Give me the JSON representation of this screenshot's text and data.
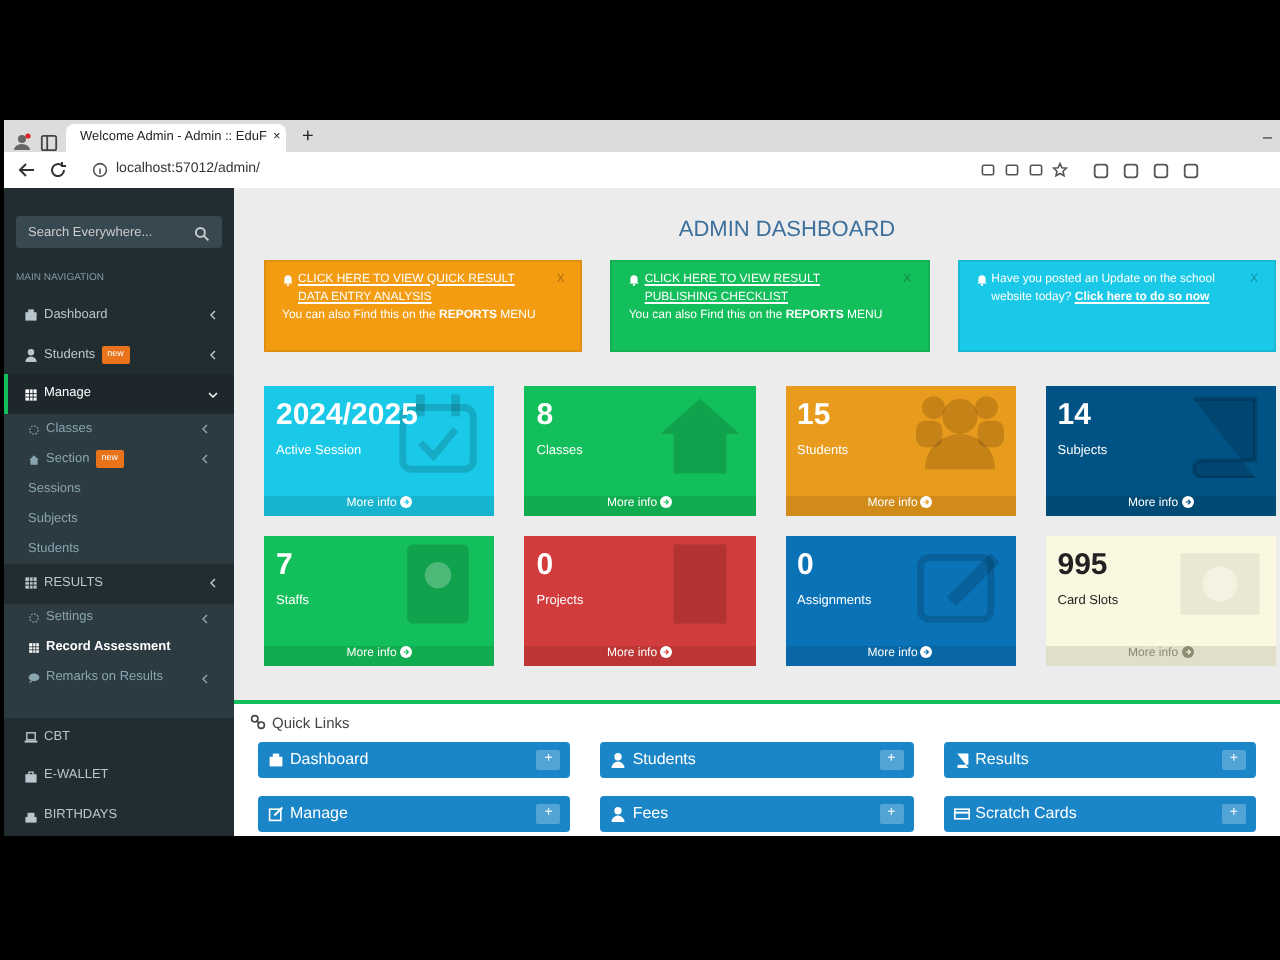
{
  "browser": {
    "tab_title": "Welcome Admin - Admin :: EduF",
    "tab_close": "×",
    "new_tab": "+",
    "minimize": "–",
    "url": "localhost:57012/admin/"
  },
  "sidebar": {
    "search_placeholder": "Search Everywhere...",
    "section_label": "MAIN NAVIGATION",
    "items": [
      {
        "kind": "menu",
        "label": "Dashboard",
        "selected": false
      },
      {
        "kind": "menu",
        "label": "Students",
        "selected": false,
        "badge": "new"
      },
      {
        "kind": "menu",
        "label": "Manage",
        "selected": true,
        "expanded": true,
        "children": [
          {
            "kind": "sub",
            "label": "Classes"
          },
          {
            "kind": "sub",
            "label": "Section",
            "badge": "new"
          },
          {
            "kind": "link",
            "label": "Sessions"
          },
          {
            "kind": "link",
            "label": "Subjects"
          },
          {
            "kind": "link",
            "label": "Students"
          }
        ]
      },
      {
        "kind": "menu",
        "label": "RESULTS",
        "selected": false,
        "expanded": false,
        "children": [
          {
            "kind": "sub",
            "label": "Settings"
          },
          {
            "kind": "bold",
            "label": "Record Assessment"
          },
          {
            "kind": "sub",
            "label": "Remarks on Results"
          }
        ]
      },
      {
        "kind": "plain",
        "label": "CBT",
        "selected": false
      },
      {
        "kind": "plain",
        "label": "E-WALLET",
        "selected": false
      },
      {
        "kind": "plain",
        "label": "BIRTHDAYS",
        "selected": false
      }
    ]
  },
  "page_title": "ADMIN DASHBOARD",
  "alerts": [
    {
      "color": "#f39c12",
      "link": "CLICK HERE TO VIEW QUICK RESULT DATA ENTRY ANALYSIS",
      "text": "You can also Find this on the **REPORTS** MENU",
      "close": "X"
    },
    {
      "color": "#13bf5a",
      "link": "CLICK HERE TO VIEW RESULT PUBLISHING CHECKLIST",
      "text": "You can also Find this on the **REPORTS** MENU",
      "close": "X"
    },
    {
      "color": "#1ac9e8",
      "text": "Have you posted an Update on the school website today?",
      "trailing_link": "Click here to do so now",
      "close": "X"
    }
  ],
  "stats": [
    {
      "value": "2024/2025",
      "label": "Active Session",
      "more": "More info",
      "color": "#1ac9e8"
    },
    {
      "value": "8",
      "label": "Classes",
      "more": "More info",
      "color": "#13bf5a"
    },
    {
      "value": "15",
      "label": "Students",
      "more": "More info",
      "color": "#e89b1c"
    },
    {
      "value": "14",
      "label": "Subjects",
      "more": "More info",
      "color": "#005384"
    },
    {
      "value": "7",
      "label": "Staffs",
      "more": "More info",
      "color": "#13bf5a"
    },
    {
      "value": "0",
      "label": "Projects",
      "more": "More info",
      "color": "#d33c3c"
    },
    {
      "value": "0",
      "label": "Assignments",
      "more": "More info",
      "color": "#0a73b7"
    },
    {
      "value": "995",
      "label": "Card Slots",
      "more": "More info",
      "color": "#fbf8e1"
    }
  ],
  "quick_links": {
    "title": "Quick Links",
    "items": [
      {
        "label": "Dashboard",
        "action": "+"
      },
      {
        "label": "Students",
        "action": "+"
      },
      {
        "label": "Results",
        "action": "+"
      },
      {
        "label": "Manage",
        "action": "+"
      },
      {
        "label": "Fees",
        "action": "+"
      },
      {
        "label": "Scratch Cards",
        "action": "+"
      }
    ]
  }
}
